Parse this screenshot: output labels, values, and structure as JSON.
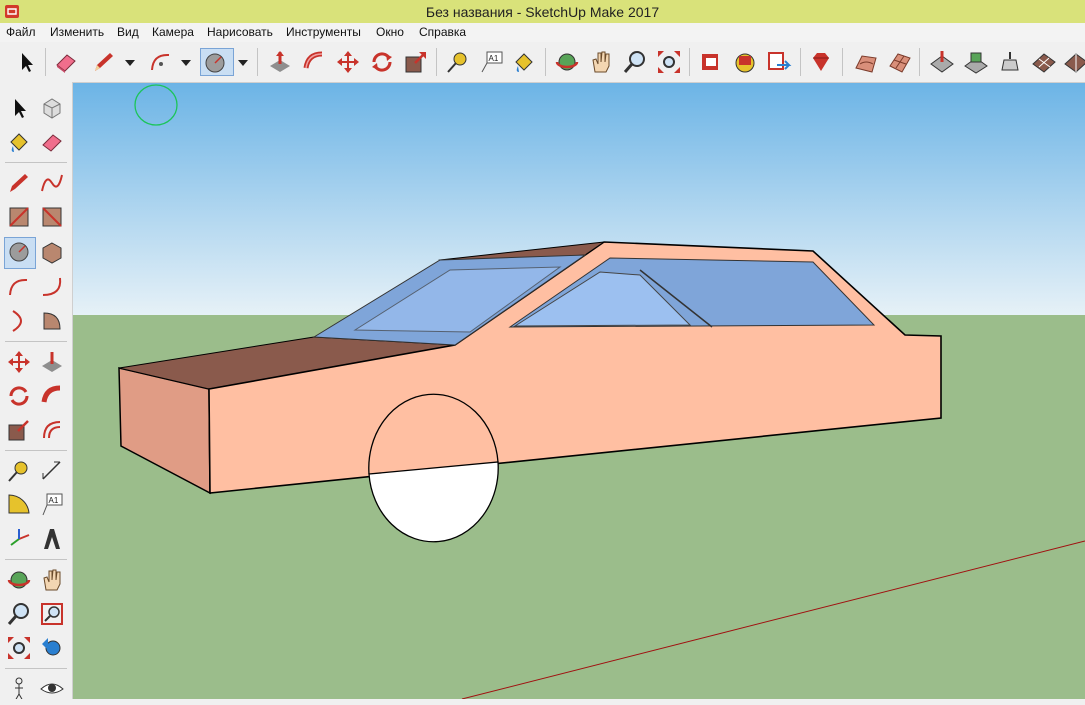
{
  "window": {
    "title": "Без названия - SketchUp Make 2017"
  },
  "menu": [
    "Файл",
    "Изменить",
    "Вид",
    "Камера",
    "Нарисовать",
    "Инструменты",
    "Окно",
    "Справка"
  ],
  "top_toolbar": {
    "icons": [
      "select-icon",
      "eraser-icon",
      "pencil-icon",
      "arc-icon",
      "circle-icon",
      "push-pull-icon",
      "follow-me-icon",
      "move-icon",
      "rotate-icon",
      "scale-icon",
      "tape-measure-icon",
      "text-icon",
      "paint-bucket-icon",
      "orbit-icon",
      "pan-icon",
      "zoom-icon",
      "zoom-extents-icon",
      "3d-warehouse-icon",
      "extension-warehouse-icon",
      "send-to-layout-icon",
      "ruby-icon",
      "sandbox-from-contours-icon",
      "sandbox-from-scratch-icon",
      "smoove-icon",
      "stamp-icon",
      "drape-icon",
      "add-detail-icon",
      "flip-edge-icon"
    ],
    "active_tool": "circle-icon"
  },
  "left_toolbar": {
    "icons": [
      "select-icon",
      "component-icon",
      "paint-bucket-icon",
      "eraser-icon",
      "pencil-icon",
      "freehand-icon",
      "rectangle-icon",
      "rotated-rectangle-icon",
      "circle-icon",
      "polygon-icon",
      "arc-icon",
      "two-point-arc-icon",
      "three-point-arc-icon",
      "pie-icon",
      "move-icon",
      "push-pull-icon",
      "rotate-icon",
      "follow-me-icon",
      "scale-icon",
      "offset-icon",
      "tape-measure-icon",
      "dimension-icon",
      "protractor-icon",
      "text-icon",
      "axes-icon",
      "3d-text-icon",
      "orbit-icon",
      "pan-icon",
      "zoom-icon",
      "zoom-window-icon",
      "zoom-extents-icon",
      "previous-view-icon",
      "position-camera-icon",
      "look-around-icon"
    ],
    "text_tool_label": "A1",
    "active_tool": "circle-icon"
  },
  "scene": {
    "colors": {
      "sky_top": "#6cb4e6",
      "sky_bottom": "#e6f1f7",
      "ground": "#9bbd8b",
      "car_side": "#ffbfa2",
      "car_front": "#e09c85",
      "hood_top": "#8a5a4c",
      "glass": "#7fa5d9",
      "glass_light": "#9cc0f0",
      "wheel": "#ffffff",
      "axis_red": "#a01010"
    }
  }
}
